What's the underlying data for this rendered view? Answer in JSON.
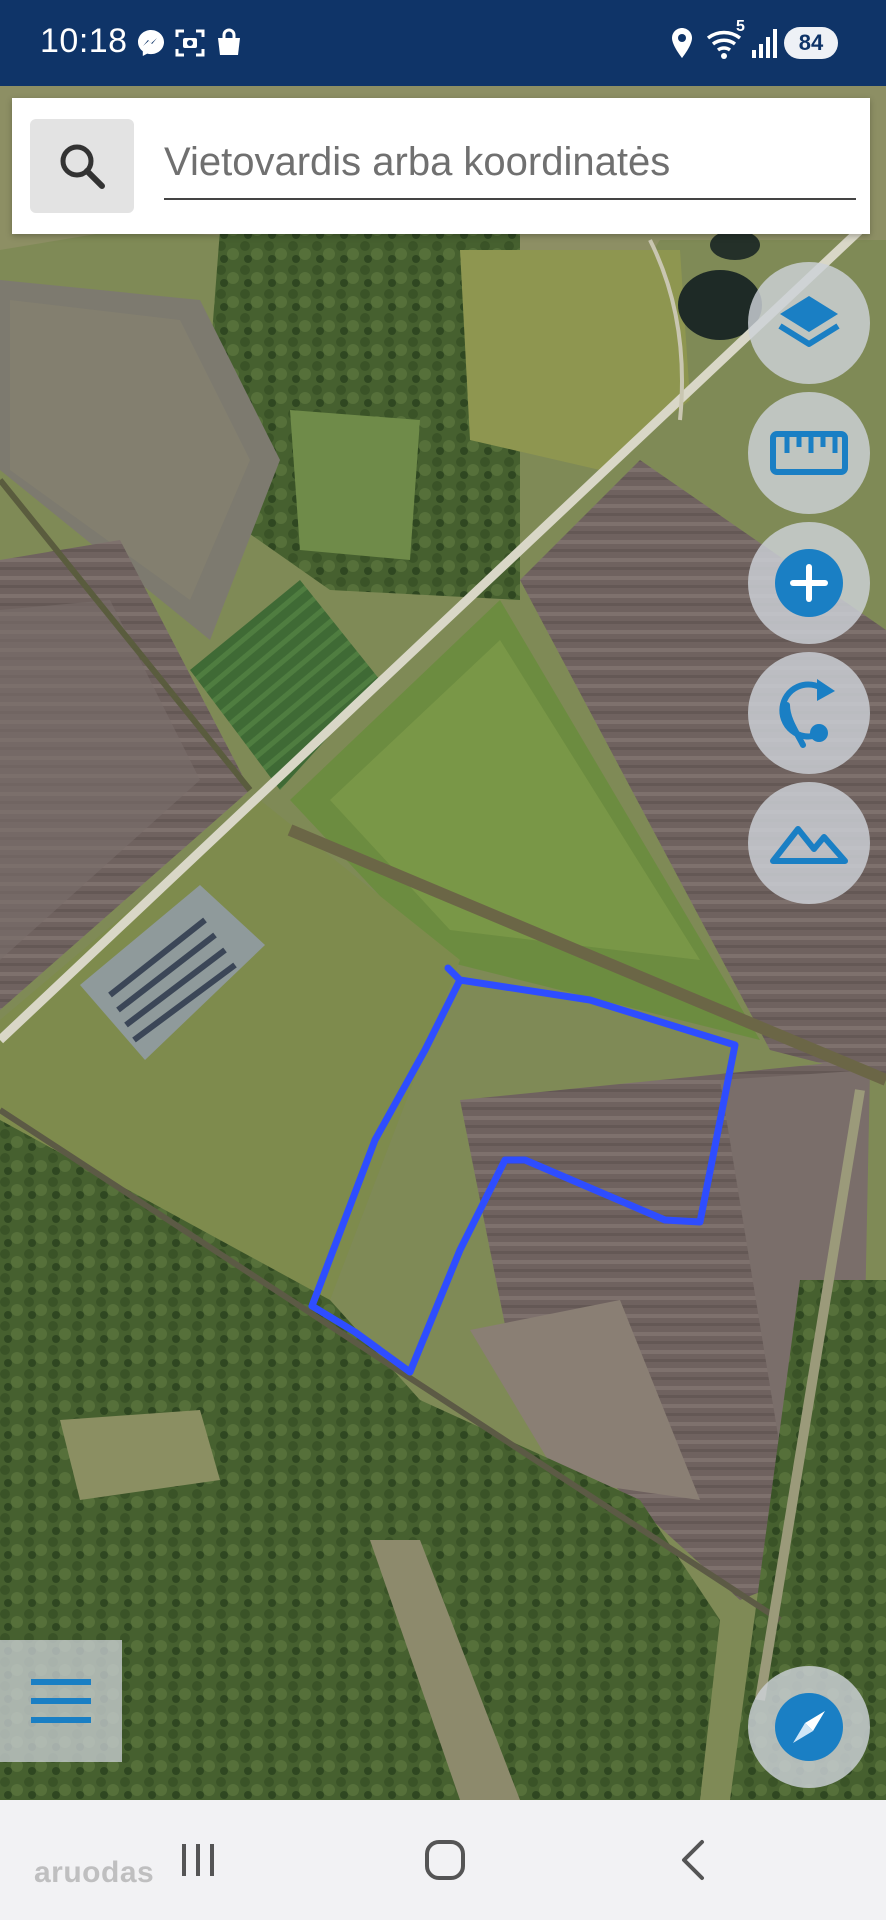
{
  "status_bar": {
    "time": "10:18",
    "battery": "84",
    "wifi_badge": "5",
    "icons": [
      "messenger-icon",
      "screenshot-icon",
      "shopping-bag-icon",
      "location-icon",
      "wifi-icon",
      "signal-icon"
    ]
  },
  "search": {
    "placeholder": "Vietovardis arba koordinatės",
    "value": ""
  },
  "tools": [
    {
      "name": "layers",
      "icon": "layers-icon"
    },
    {
      "name": "measure",
      "icon": "ruler-icon"
    },
    {
      "name": "add",
      "icon": "plus-icon"
    },
    {
      "name": "rotate",
      "icon": "rotate-location-icon"
    },
    {
      "name": "terrain",
      "icon": "mountain-icon"
    }
  ],
  "menu": {
    "icon": "hamburger-menu-icon"
  },
  "compass": {
    "icon": "compass-icon"
  },
  "nav": {
    "buttons": [
      "recent-apps-icon",
      "home-icon",
      "back-icon"
    ]
  },
  "watermark": "aruodas",
  "colors": {
    "status_bar": "#0f3468",
    "accent": "#1a7fc4",
    "outline": "#2e4dff"
  }
}
